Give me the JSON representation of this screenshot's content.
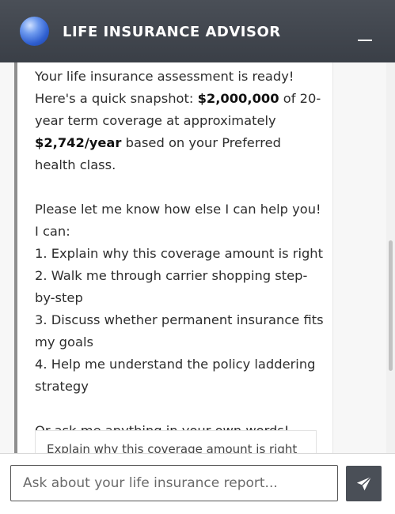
{
  "header": {
    "title": "LIFE INSURANCE ADVISOR",
    "logo_icon": "globe-icon",
    "minimize_icon": "minimize-icon"
  },
  "message": {
    "intro_1": "Your life insurance assessment is ready! Here's a quick snapshot: ",
    "coverage": "$2,000,000",
    "intro_2": " of 20-year term coverage at approximately ",
    "premium": "$2,742/year",
    "intro_3": " based on your Preferred health class.",
    "help_prompt": "Please let me know how else I can help you! I can:",
    "options": [
      "1. Explain why this coverage amount is right",
      "2. Walk me through carrier shopping step-by-step",
      "3. Discuss whether permanent insurance fits my goals",
      "4. Help me understand the policy laddering strategy"
    ],
    "closing": "Or ask me anything in your own words!"
  },
  "suggestion": {
    "label": "Explain why this coverage amount is right"
  },
  "input": {
    "placeholder": "Ask about your life insurance report...",
    "value": ""
  },
  "send": {
    "icon": "send-icon"
  },
  "colors": {
    "header_bg": "#40454d",
    "send_bg": "#4a4f57",
    "accent_border": "#8e8e8e"
  }
}
